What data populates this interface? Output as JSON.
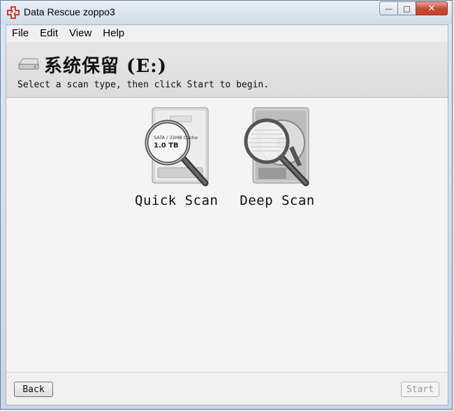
{
  "window": {
    "title": "Data Rescue zoppo3",
    "minimize_glyph": "—",
    "maximize_glyph": "□",
    "close_glyph": "✕"
  },
  "menu": {
    "items": [
      "File",
      "Edit",
      "View",
      "Help"
    ]
  },
  "header": {
    "volume_title": "系统保留 (E:)",
    "instruction": "Select a scan type, then click Start to begin."
  },
  "scan_options": [
    {
      "label": "Quick Scan",
      "icon": "quick-scan-drive-magnifier-icon",
      "drive_label_line1": "SATA / 32MB Cache",
      "drive_label_line2": "1.0 TB"
    },
    {
      "label": "Deep Scan",
      "icon": "deep-scan-open-drive-magnifier-icon"
    }
  ],
  "footer": {
    "back_label": "Back",
    "start_label": "Start"
  },
  "colors": {
    "titlebar": "#dbe7f3",
    "close_button": "#c9462b",
    "app_icon_red": "#d8342c"
  }
}
